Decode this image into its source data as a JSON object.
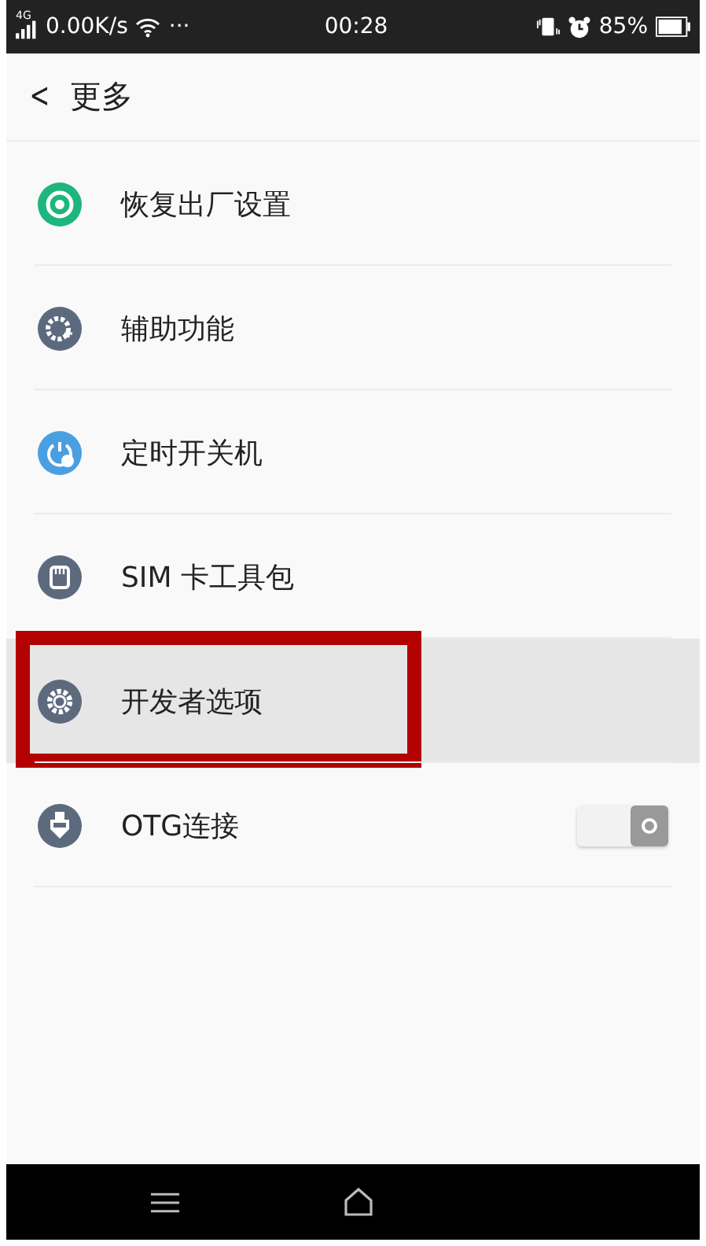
{
  "status_bar": {
    "network": "4G",
    "speed": "0.00K/s",
    "more": "···",
    "time": "00:28",
    "battery": "85%"
  },
  "header": {
    "back": "<",
    "title": "更多"
  },
  "items": [
    {
      "label": "恢复出厂设置",
      "color": "#1fb57e",
      "selected": false,
      "highlighted": false
    },
    {
      "label": "辅助功能",
      "color": "#5d6a7e",
      "selected": false,
      "highlighted": false
    },
    {
      "label": "定时开关机",
      "color": "#4a9fe0",
      "selected": false,
      "highlighted": false
    },
    {
      "label": "SIM 卡工具包",
      "color": "#5d6a7e",
      "selected": false,
      "highlighted": false
    },
    {
      "label": "开发者选项",
      "color": "#5d6a7e",
      "selected": true,
      "highlighted": true
    },
    {
      "label": "OTG连接",
      "color": "#5d6a7e",
      "selected": false,
      "highlighted": false,
      "toggle": {
        "on": true
      }
    }
  ]
}
